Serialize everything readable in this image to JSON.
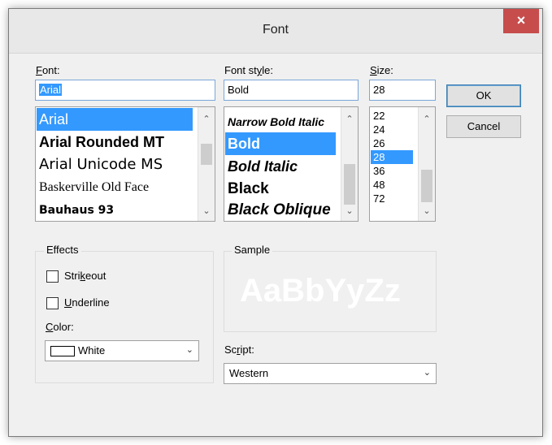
{
  "window": {
    "title": "Font",
    "close_glyph": "×"
  },
  "font": {
    "label_prefix": "",
    "label_underlined": "F",
    "label_rest": "ont:",
    "value": "Arial",
    "list": [
      "Arial",
      "Arial Rounded MT",
      "Arial Unicode MS",
      "Baskerville Old Face",
      "Bauhaus 93"
    ],
    "selected": "Arial"
  },
  "style": {
    "label_prefix": "Font st",
    "label_underlined": "y",
    "label_rest": "le:",
    "value": "Bold",
    "list": [
      "Narrow Bold Italic",
      "Bold",
      "Bold Italic",
      "Black",
      "Black Oblique"
    ],
    "selected": "Bold"
  },
  "size": {
    "label_prefix": "",
    "label_underlined": "S",
    "label_rest": "ize:",
    "value": "28",
    "list": [
      "22",
      "24",
      "26",
      "28",
      "36",
      "48",
      "72"
    ],
    "selected": "28"
  },
  "buttons": {
    "ok": "OK",
    "cancel": "Cancel"
  },
  "effects": {
    "title": "Effects",
    "strikeout_prefix": "Stri",
    "strikeout_underlined": "k",
    "strikeout_rest": "eout",
    "strikeout_checked": false,
    "underline_prefix": "",
    "underline_underlined": "U",
    "underline_rest": "nderline",
    "underline_checked": false,
    "color_prefix": "",
    "color_underlined": "C",
    "color_rest": "olor:",
    "color_value": "White",
    "color_swatch": "#ffffff"
  },
  "sample": {
    "title": "Sample",
    "text": "AaBbYyZz"
  },
  "script": {
    "label_prefix": "Sc",
    "label_underlined": "r",
    "label_rest": "ipt:",
    "value": "Western"
  },
  "icons": {
    "scroll_up": "up-arrow-icon",
    "scroll_down": "down-arrow-icon",
    "dropdown": "chevron-down-icon",
    "close": "close-icon"
  },
  "colors": {
    "selection": "#3399ff",
    "close_button": "#c74d4d"
  }
}
